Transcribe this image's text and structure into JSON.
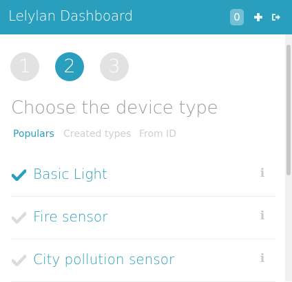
{
  "header": {
    "title": "Lelylan Dashboard",
    "notification_count": "0",
    "add_icon": "plus-icon",
    "logout_icon": "logout-icon"
  },
  "wizard": {
    "steps": [
      {
        "label": "1",
        "active": false
      },
      {
        "label": "2",
        "active": true
      },
      {
        "label": "3",
        "active": false
      }
    ],
    "title": "Choose the device type",
    "tabs": [
      {
        "label": "Populars",
        "active": true
      },
      {
        "label": "Created types",
        "active": false
      },
      {
        "label": "From ID",
        "active": false
      }
    ],
    "devices": [
      {
        "label": "Basic Light",
        "selected": true,
        "info_icon": "info-icon"
      },
      {
        "label": "Fire sensor",
        "selected": false,
        "info_icon": "info-icon"
      },
      {
        "label": "City pollution sensor",
        "selected": false,
        "info_icon": "info-icon"
      }
    ]
  },
  "colors": {
    "accent": "#2a9fbd",
    "check_selected": "#2a9fbd",
    "check_unselected": "#dcdcdc",
    "muted_text": "#9b9b9b",
    "tab_inactive": "#cfcfcf"
  }
}
